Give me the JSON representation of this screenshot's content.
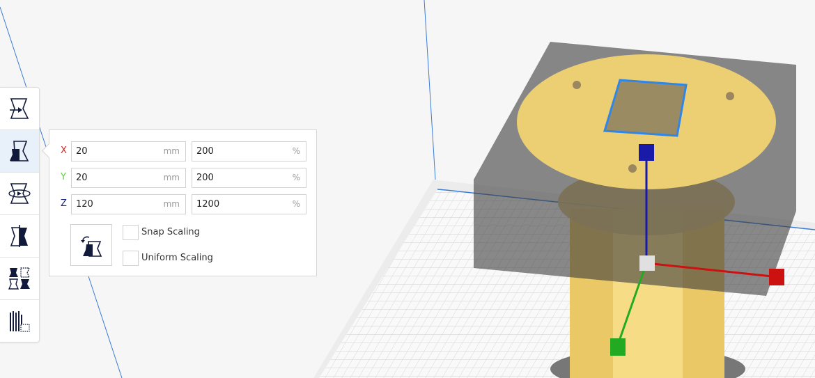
{
  "toolbar": {
    "tools": [
      {
        "name": "move",
        "icon": "move-tool-icon",
        "active": false
      },
      {
        "name": "scale",
        "icon": "scale-tool-icon",
        "active": true
      },
      {
        "name": "rotate",
        "icon": "rotate-tool-icon",
        "active": false
      },
      {
        "name": "mirror",
        "icon": "mirror-tool-icon",
        "active": false
      },
      {
        "name": "per-model-settings",
        "icon": "per-model-settings-icon",
        "active": false
      },
      {
        "name": "support-blocker",
        "icon": "support-blocker-icon",
        "active": false
      }
    ]
  },
  "scale_panel": {
    "rows": [
      {
        "axis": "X",
        "color": "#c62828",
        "mm": "20",
        "mm_unit": "mm",
        "percent": "200",
        "percent_unit": "%"
      },
      {
        "axis": "Y",
        "color": "#5fcf3f",
        "mm": "20",
        "mm_unit": "mm",
        "percent": "200",
        "percent_unit": "%"
      },
      {
        "axis": "Z",
        "color": "#1a237e",
        "mm": "120",
        "mm_unit": "mm",
        "percent": "1200",
        "percent_unit": "%"
      }
    ],
    "reset_icon": "reset-scale-icon",
    "snap_scaling": {
      "label": "Snap Scaling",
      "checked": false
    },
    "uniform_scaling": {
      "label": "Uniform Scaling",
      "checked": false
    }
  },
  "colors": {
    "accent": "#1f2a5a",
    "model": "#f3d06b",
    "gizmo_x": "#cc1111",
    "gizmo_y": "#22aa22",
    "gizmo_z": "#1a1aa8"
  }
}
